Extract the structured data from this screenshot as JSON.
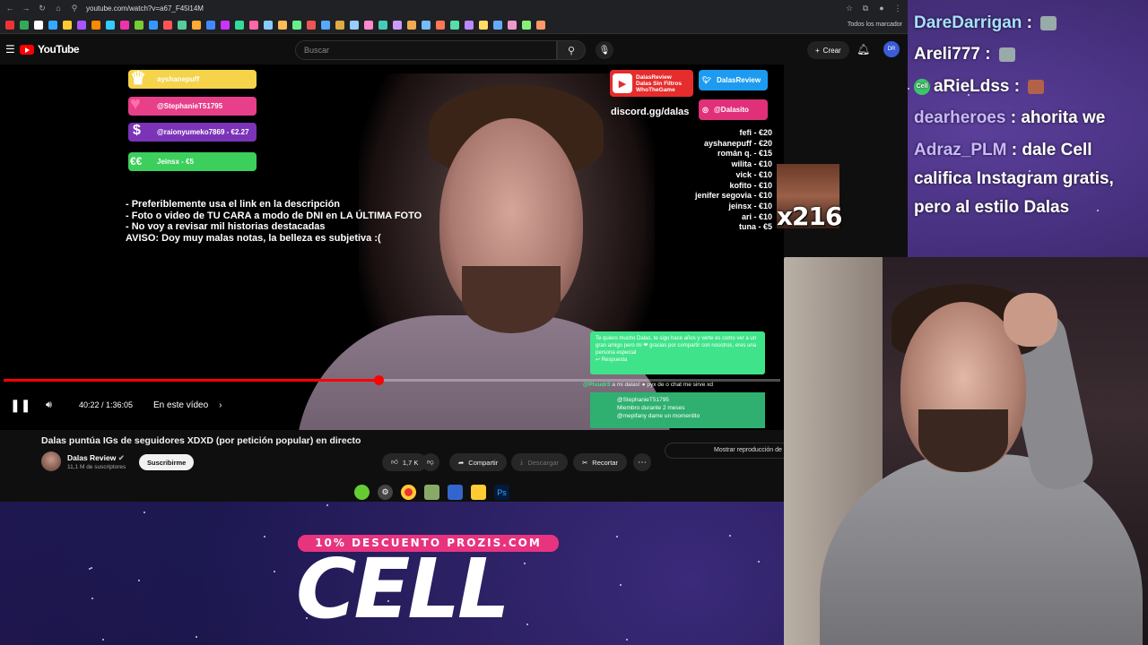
{
  "browser": {
    "url": "youtube.com/watch?v=a67_F45l14M",
    "bookmarks_label": "Todos los marcador"
  },
  "youtube": {
    "logo": "YouTube",
    "search_placeholder": "Buscar",
    "create_label": "Crear",
    "account_initials": "DR"
  },
  "overlay": {
    "badges": [
      {
        "label": "ayshanepuff",
        "color": "#f5d34a",
        "icon": "crown-icon"
      },
      {
        "label": "@StephanieT51795",
        "color": "#e83f8a",
        "icon": "heart-icon"
      },
      {
        "label": "@raionyumeko7869 - €2.27",
        "color": "#7b34b8",
        "icon": "coin-icon"
      },
      {
        "label": "Jeinsx - €5",
        "color": "#3ccf5c",
        "icon": "money-icon"
      }
    ],
    "rules": [
      "- Preferiblemente usa el link en la descripción",
      "- Foto o video de TU CARA a modo de DNI en LA ÚLTIMA FOTO",
      "- No voy a revisar mil historias destacadas",
      "AVISO: Doy muy malas notas, la belleza es subjetiva :("
    ],
    "yt_social": [
      "DalasReview",
      "Dalas Sin Filtros",
      "WhoTheGame"
    ],
    "twitter": "DalasReview",
    "discord": "discord.gg/dalas",
    "instagram": "@Dalasito",
    "donations": [
      "fefi - €20",
      "ayshanepuff - €20",
      "román q. - €15",
      "wilita - €10",
      "vick - €10",
      "kofito - €10",
      "jenifer segovia - €10",
      "jeinsx - €10",
      "ari - €10",
      "tuna - €5"
    ],
    "meme_count": "x216",
    "chat_box_1": "Te quiero mucho Dalas, te sigo hace años y verte es como ver a un gran amigo pero mi ❤ gracias por compartir con nosotros, eres una persona especial",
    "chat_box_1_footer": "Respuesta",
    "chat_line": {
      "user": "@Pluudr3",
      "text": "a mi dalas! ● pyx de o chat me sirve xd"
    },
    "chat_box_2": {
      "user": "@StephanieT51795",
      "badge": "Miembro durante 2 meses",
      "msg": "@mepifany dame un momentito"
    }
  },
  "player": {
    "progress": 0.4824,
    "time": "40:22 / 1:36:05",
    "chapter": "En este vídeo"
  },
  "video_info": {
    "title": "Dalas puntúa IGs de seguidores XDXD (por petición popular) en directo",
    "channel": "Dalas Review",
    "subscribers": "11,1 M de suscriptores",
    "subscribe": "Suscribirme",
    "likes": "1,7 K",
    "share": "Compartir",
    "download": "Descargar",
    "clip": "Recortar",
    "replay": "Mostrar reproducción de chat"
  },
  "stream_chat": [
    {
      "user": "DareDarrigan",
      "sep": " : ",
      "msg": "",
      "color": "#a8e0ff",
      "emote": true
    },
    {
      "user": "Areli777",
      "sep": " : ",
      "msg": "",
      "color": "#ffffff",
      "emote": true
    },
    {
      "user": "aRieLdss",
      "sep": " : ",
      "msg": "",
      "color": "#ffffff",
      "emote": true,
      "badge": "Cell"
    },
    {
      "user": "dearheroes",
      "sep": " : ",
      "msg": "ahorita we",
      "color": "#c9b8ff"
    },
    {
      "user": "Adraz_PLM",
      "sep": " : ",
      "msg": "dale Cell",
      "color": "#c9b8ff"
    }
  ],
  "stream_chat_cont": [
    "califica Instagram gratis,",
    "pero al estilo Dalas"
  ],
  "promo": {
    "pill": "10% DESCUENTO PROZIS.COM",
    "big": "CELL"
  }
}
